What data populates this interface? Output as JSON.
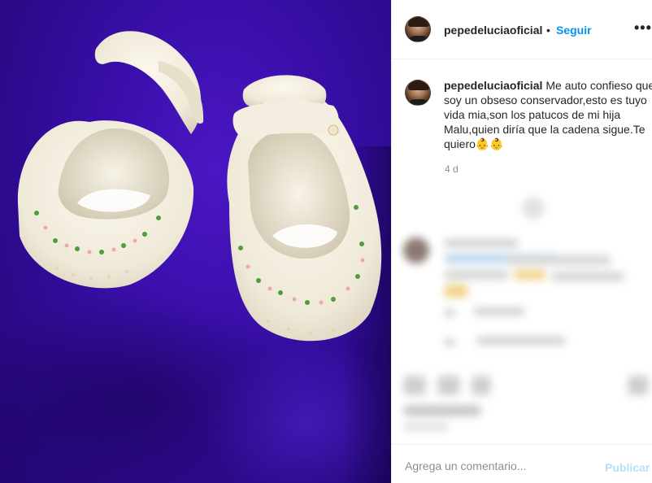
{
  "post": {
    "username": "pepedeluciaoficial",
    "separator": "•",
    "follow_label": "Seguir",
    "more_label": "•••"
  },
  "caption": {
    "username": "pepedeluciaoficial",
    "text": "Me auto confieso que soy un obseso conservador,esto es tuyo vida mia,son los patucos de mi hija Malu,quien diría que la cadena sigue.Te quiero👶👶",
    "time": "4 d"
  },
  "comment_box": {
    "placeholder": "Agrega un comentario...",
    "publish_label": "Publicar"
  },
  "colors": {
    "accent": "#0095f6",
    "publish_disabled": "#b2dffc",
    "background_cloth": "#3a0fab"
  }
}
